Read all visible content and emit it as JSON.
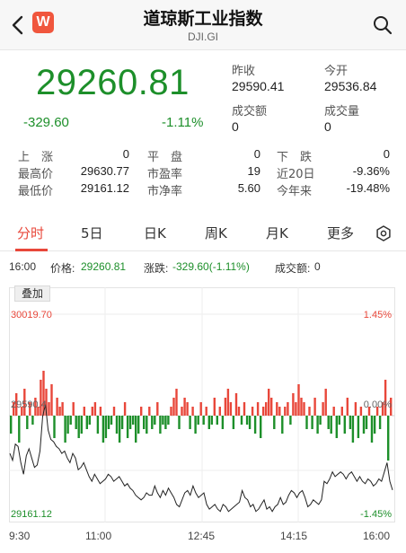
{
  "header": {
    "title": "道琼斯工业指数",
    "code": "DJI.GI",
    "logo_letter": "W"
  },
  "quote": {
    "price": "29260.81",
    "change": "-329.60",
    "change_pct": "-1.11%",
    "prev_close_label": "昨收",
    "prev_close": "29590.41",
    "open_label": "今开",
    "open": "29536.84",
    "turnover_label": "成交额",
    "turnover": "0",
    "volume_label": "成交量",
    "volume": "0"
  },
  "stats": {
    "up_label": "上　涨",
    "up": "0",
    "flat_label": "平　盘",
    "flat": "0",
    "down_label": "下　跌",
    "down": "0",
    "high_label": "最高价",
    "high": "29630.77",
    "pe_label": "市盈率",
    "pe": "19",
    "d20_label": "近20日",
    "d20": "-9.36%",
    "low_label": "最低价",
    "low": "29161.12",
    "pb_label": "市净率",
    "pb": "5.60",
    "ytd_label": "今年来",
    "ytd": "-19.48%"
  },
  "tabs": [
    "分时",
    "5日",
    "日K",
    "周K",
    "月K",
    "更多"
  ],
  "info_bar": {
    "time": "16:00",
    "price_label": "价格:",
    "price": "29260.81",
    "change_label": "涨跌:",
    "change": "-329.60(-1.11%)",
    "turnover_label": "成交额:",
    "turnover": "0"
  },
  "overlay_button": "叠加",
  "colors": {
    "up": "#e8473a",
    "down": "#1d8f2a",
    "accent": "#e8473a"
  },
  "chart_data": {
    "type": "line",
    "y_labels": {
      "top": "30019.70",
      "mid": "29590.4",
      "bottom": "29161.12"
    },
    "pct_labels": {
      "top": "1.45%",
      "mid": "0.00%",
      "bottom": "-1.45%"
    },
    "x_ticks": [
      "9:30",
      "11:00",
      "12:45",
      "14:15",
      "16:00"
    ],
    "ylim": [
      29161.12,
      30019.7
    ],
    "baseline": 29590.41,
    "price_series": [
      29420,
      29390,
      29460,
      29450,
      29380,
      29330,
      29410,
      29440,
      29400,
      29360,
      29370,
      29430,
      29580,
      29630,
      29520,
      29480,
      29470,
      29450,
      29440,
      29420,
      29430,
      29400,
      29380,
      29420,
      29400,
      29350,
      29360,
      29380,
      29350,
      29320,
      29300,
      29330,
      29310,
      29290,
      29300,
      29310,
      29330,
      29320,
      29300,
      29310,
      29320,
      29300,
      29280,
      29290,
      29270,
      29260,
      29240,
      29230,
      29220,
      29230,
      29250,
      29240,
      29240,
      29280,
      29250,
      29230,
      29260,
      29240,
      29270,
      29250,
      29230,
      29200,
      29190,
      29220,
      29250,
      29260,
      29240,
      29280,
      29250,
      29230,
      29240,
      29250,
      29200,
      29180,
      29190,
      29200,
      29180,
      29170,
      29200,
      29190,
      29170,
      29180,
      29190,
      29200,
      29210,
      29260,
      29230,
      29220,
      29190,
      29200,
      29170,
      29180,
      29200,
      29220,
      29180,
      29190,
      29170,
      29190,
      29200,
      29230,
      29200,
      29210,
      29240,
      29260,
      29250,
      29230,
      29250,
      29260,
      29230,
      29190,
      29200,
      29220,
      29210,
      29200,
      29220,
      29300,
      29290,
      29310,
      29340,
      29320,
      29330,
      29340,
      29330,
      29310,
      29330,
      29340,
      29320,
      29300,
      29320,
      29300,
      29290,
      29310,
      29300,
      29280,
      29290,
      29310,
      29300,
      29340,
      29380,
      29300,
      29262
    ],
    "volume_bars": [
      -0.4,
      0.3,
      0.5,
      -0.6,
      0.2,
      0.6,
      -0.3,
      0.3,
      -0.2,
      0.4,
      0.2,
      0.8,
      1.0,
      0.6,
      0.3,
      0.7,
      -0.5,
      0.4,
      0.2,
      0.3,
      -0.6,
      -0.4,
      -0.2,
      0.3,
      -0.3,
      -0.5,
      -0.4,
      0.2,
      -0.3,
      -0.2,
      0.2,
      0.3,
      -0.4,
      0.2,
      -0.6,
      -0.5,
      -0.3,
      -0.2,
      0.2,
      -0.4,
      -0.6,
      -0.3,
      0.3,
      -0.5,
      -0.3,
      -0.2,
      -0.6,
      -0.4,
      0.2,
      -0.3,
      -0.4,
      0.2,
      -0.3,
      -0.2,
      0.3,
      -0.4,
      -0.2,
      -0.3,
      -0.2,
      0.2,
      0.4,
      0.6,
      -0.3,
      0.2,
      0.4,
      0.3,
      -0.3,
      0.2,
      -0.4,
      -0.2,
      0.3,
      -0.2,
      0.2,
      -0.3,
      -0.2,
      0.4,
      -0.2,
      0.2,
      -0.3,
      0.4,
      0.6,
      0.3,
      -0.3,
      0.5,
      0.2,
      -0.2,
      0.3,
      -0.2,
      -0.3,
      0.2,
      -0.4,
      0.3,
      -0.5,
      0.2,
      0.3,
      0.6,
      0.4,
      -0.3,
      0.3,
      0.2,
      -0.4,
      0.2,
      0.3,
      -0.2,
      0.5,
      0.3,
      0.7,
      0.4,
      0.3,
      -0.3,
      0.2,
      -0.3,
      0.4,
      -0.4,
      -0.2,
      0.3,
      0.6,
      -0.3,
      -0.4,
      0.2,
      -0.5,
      -0.2,
      0.2,
      -0.4,
      0.4,
      -0.3,
      -0.6,
      0.3,
      -0.5,
      0.2,
      -0.4,
      -0.3,
      0.2,
      -0.6,
      -0.4,
      0.2,
      -0.3,
      0.3,
      0.8,
      -1.0,
      0.4
    ]
  }
}
